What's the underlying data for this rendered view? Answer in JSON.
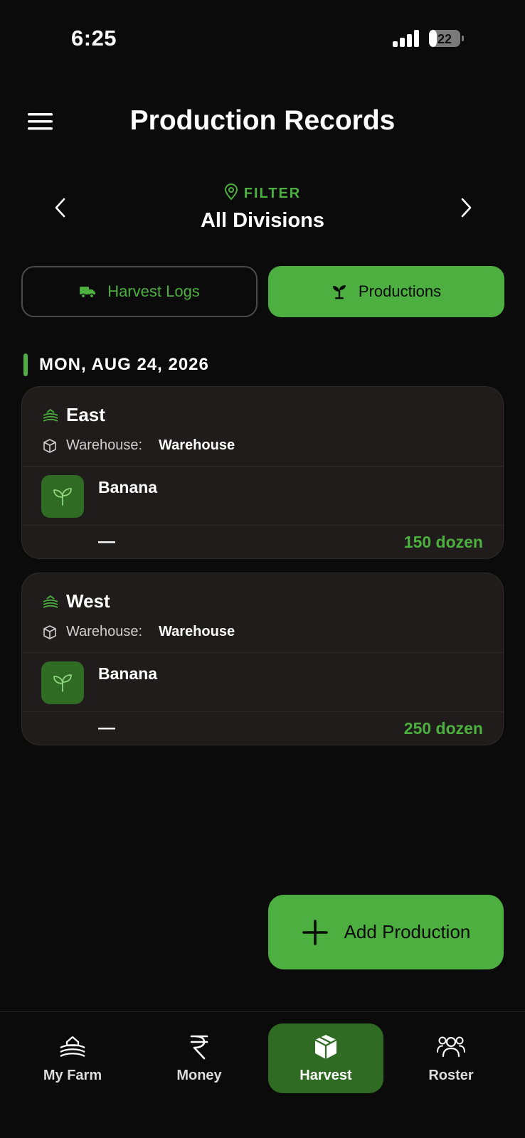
{
  "status_bar": {
    "time": "6:25",
    "battery": "22"
  },
  "header": {
    "title": "Production Records",
    "menu_icon": "hamburger-menu-icon"
  },
  "filter": {
    "label": "FILTER",
    "value": "All Divisions"
  },
  "tabs": [
    {
      "label": "Harvest Logs",
      "icon": "truck-icon",
      "selected": false
    },
    {
      "label": "Productions",
      "icon": "sprout-icon",
      "selected": true
    }
  ],
  "date_header": "MON, AUG 24, 2026",
  "records": [
    {
      "division": "East",
      "warehouse_label": "Warehouse:",
      "warehouse": "Warehouse",
      "item": "Banana",
      "note": "—",
      "quantity": "150 dozen"
    },
    {
      "division": "West",
      "warehouse_label": "Warehouse:",
      "warehouse": "Warehouse",
      "item": "Banana",
      "note": "—",
      "quantity": "250 dozen"
    }
  ],
  "fab": {
    "label": "Add Production",
    "icon": "plus-icon"
  },
  "nav": [
    {
      "label": "My Farm",
      "icon": "farm-icon"
    },
    {
      "label": "Money",
      "icon": "rupee-icon"
    },
    {
      "label": "Harvest",
      "icon": "box-icon",
      "active": true
    },
    {
      "label": "Roster",
      "icon": "users-icon"
    }
  ],
  "colors": {
    "accent": "#4caf3f",
    "accent_dark": "#2f6b22",
    "background": "#0b0b0b",
    "card": "#1f1c1b"
  }
}
